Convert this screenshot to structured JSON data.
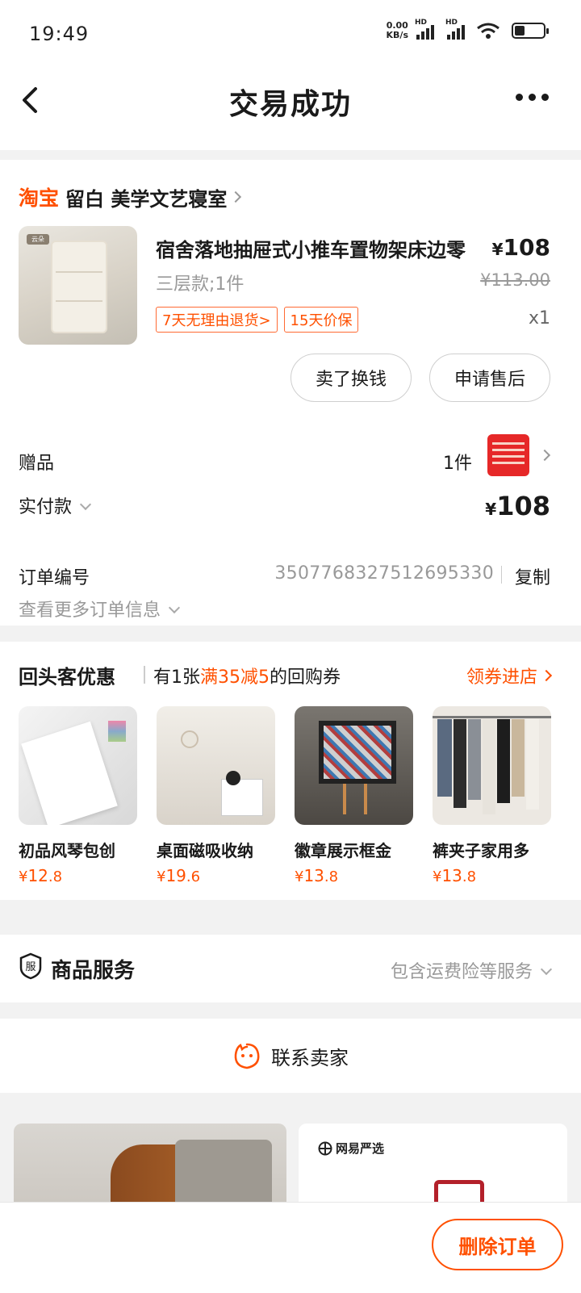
{
  "status": {
    "time": "19:49",
    "net_speed_value": "0.00",
    "net_speed_unit": "KB/s",
    "sim1_label": "HD",
    "sim2_label": "HD"
  },
  "nav": {
    "title": "交易成功",
    "back_icon": "chevron-left-icon",
    "more_icon": "more-dots-icon"
  },
  "order": {
    "platform": "淘宝",
    "shop_name": "留白 美学文艺寝室",
    "product": {
      "thumb_tag": "云朵",
      "title": "宿舍落地抽屉式小推车置物架床边零",
      "price_symbol": "¥",
      "price": "108",
      "spec": "三层款;1件",
      "original_price": "¥113.00",
      "badges": [
        "7天无理由退货>",
        "15天价保"
      ],
      "qty": "x1"
    },
    "buttons": {
      "sell": "卖了换钱",
      "after_sale": "申请售后"
    },
    "gift": {
      "label": "赠品",
      "count": "1件"
    },
    "payment": {
      "label": "实付款",
      "symbol": "¥",
      "amount": "108"
    },
    "order_no": {
      "label": "订单编号",
      "value": "3507768327512695330",
      "copy": "复制"
    },
    "more_info": "查看更多订单信息"
  },
  "returning": {
    "title": "回头客优惠",
    "desc_pre": "有1张",
    "desc_hl": "满35减5",
    "desc_post": "的回购券",
    "link": "领券进店",
    "items": [
      {
        "name": "初品风琴包创",
        "symbol": "¥",
        "int": "12",
        "dec": ".8"
      },
      {
        "name": "桌面磁吸收纳",
        "symbol": "¥",
        "int": "19",
        "dec": ".6"
      },
      {
        "name": "徽章展示框金",
        "symbol": "¥",
        "int": "13",
        "dec": ".8"
      },
      {
        "name": "裤夹子家用多",
        "symbol": "¥",
        "int": "13",
        "dec": ".8"
      }
    ]
  },
  "service": {
    "icon_text": "服",
    "title": "商品服务",
    "desc": "包含运费险等服务"
  },
  "contact": {
    "label": "联系卖家"
  },
  "ad": {
    "brand": "网易严选"
  },
  "bottom": {
    "delete": "删除订单"
  },
  "colors": {
    "accent": "#ff5000",
    "text": "#1a1a1a",
    "muted": "#999999",
    "background": "#f2f2f2"
  }
}
